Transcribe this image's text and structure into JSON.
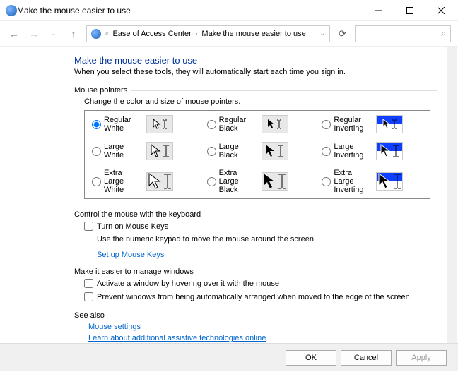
{
  "window": {
    "title": "Make the mouse easier to use"
  },
  "breadcrumb": {
    "a": "Ease of Access Center",
    "b": "Make the mouse easier to use"
  },
  "header": {
    "title": "Make the mouse easier to use",
    "subtitle": "When you select these tools, they will automatically start each time you sign in."
  },
  "pointers": {
    "section": "Mouse pointers",
    "desc": "Change the color and size of mouse pointers.",
    "opts": {
      "rw": "Regular White",
      "rb": "Regular Black",
      "ri": "Regular Inverting",
      "lw": "Large White",
      "lb": "Large Black",
      "li": "Large Inverting",
      "xw": "Extra Large White",
      "xb": "Extra Large Black",
      "xi": "Extra Large Inverting"
    }
  },
  "keyboard": {
    "section": "Control the mouse with the keyboard",
    "chk": "Turn on Mouse Keys",
    "desc": "Use the numeric keypad to move the mouse around the screen.",
    "link": "Set up Mouse Keys"
  },
  "windows": {
    "section": "Make it easier to manage windows",
    "chk1": "Activate a window by hovering over it with the mouse",
    "chk2": "Prevent windows from being automatically arranged when moved to the edge of the screen"
  },
  "seealso": {
    "section": "See also",
    "link1": "Mouse settings",
    "link2": "Learn about additional assistive technologies online"
  },
  "buttons": {
    "ok": "OK",
    "cancel": "Cancel",
    "apply": "Apply"
  }
}
